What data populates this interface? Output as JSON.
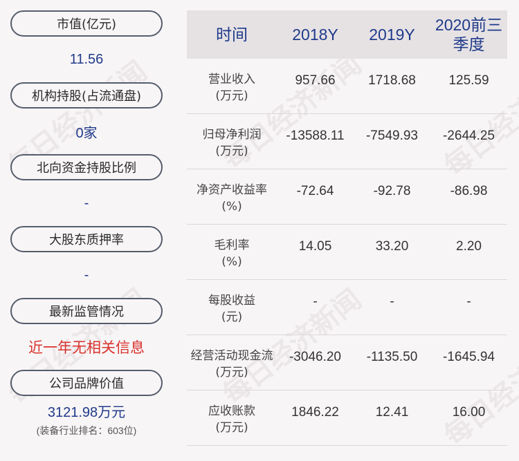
{
  "watermark": "每日经济新闻",
  "left_panel": [
    {
      "label": "市值(亿元)",
      "value": "11.56"
    },
    {
      "label": "机构持股(占流通盘)",
      "value": "0家"
    },
    {
      "label": "北向资金持股比例",
      "value": "-"
    },
    {
      "label": "大股东质押率",
      "value": "-"
    },
    {
      "label": "最新监管情况",
      "value": "近一年无相关信息"
    },
    {
      "label": "公司品牌价值",
      "value": "3121.98万元",
      "sub": "(装备行业排名：603位)"
    }
  ],
  "table": {
    "headers": [
      "时间",
      "2018Y",
      "2019Y",
      "2020前三季度"
    ],
    "rows": [
      {
        "label": [
          "营业收入",
          "(万元)"
        ],
        "values": [
          "957.66",
          "1718.68",
          "125.59"
        ]
      },
      {
        "label": [
          "归母净利润",
          "(万元)"
        ],
        "values": [
          "-13588.11",
          "-7549.93",
          "-2644.25"
        ]
      },
      {
        "label": [
          "净资产收益率",
          "(%)"
        ],
        "values": [
          "-72.64",
          "-92.78",
          "-86.98"
        ]
      },
      {
        "label": [
          "毛利率",
          "(%)"
        ],
        "values": [
          "14.05",
          "33.20",
          "2.20"
        ]
      },
      {
        "label": [
          "每股收益",
          "(元)"
        ],
        "values": [
          "-",
          "-",
          "-"
        ]
      },
      {
        "label": [
          "经营活动现金流",
          "(万元)"
        ],
        "values": [
          "-3046.20",
          "-1135.50",
          "-1645.94"
        ]
      },
      {
        "label": [
          "应收账款",
          "(万元)"
        ],
        "values": [
          "1846.22",
          "12.41",
          "16.00"
        ]
      }
    ]
  },
  "colors": {
    "value_blue": "#1f3a8a",
    "alert_red": "#d9312c",
    "header_bg": "#e6e2e4"
  }
}
